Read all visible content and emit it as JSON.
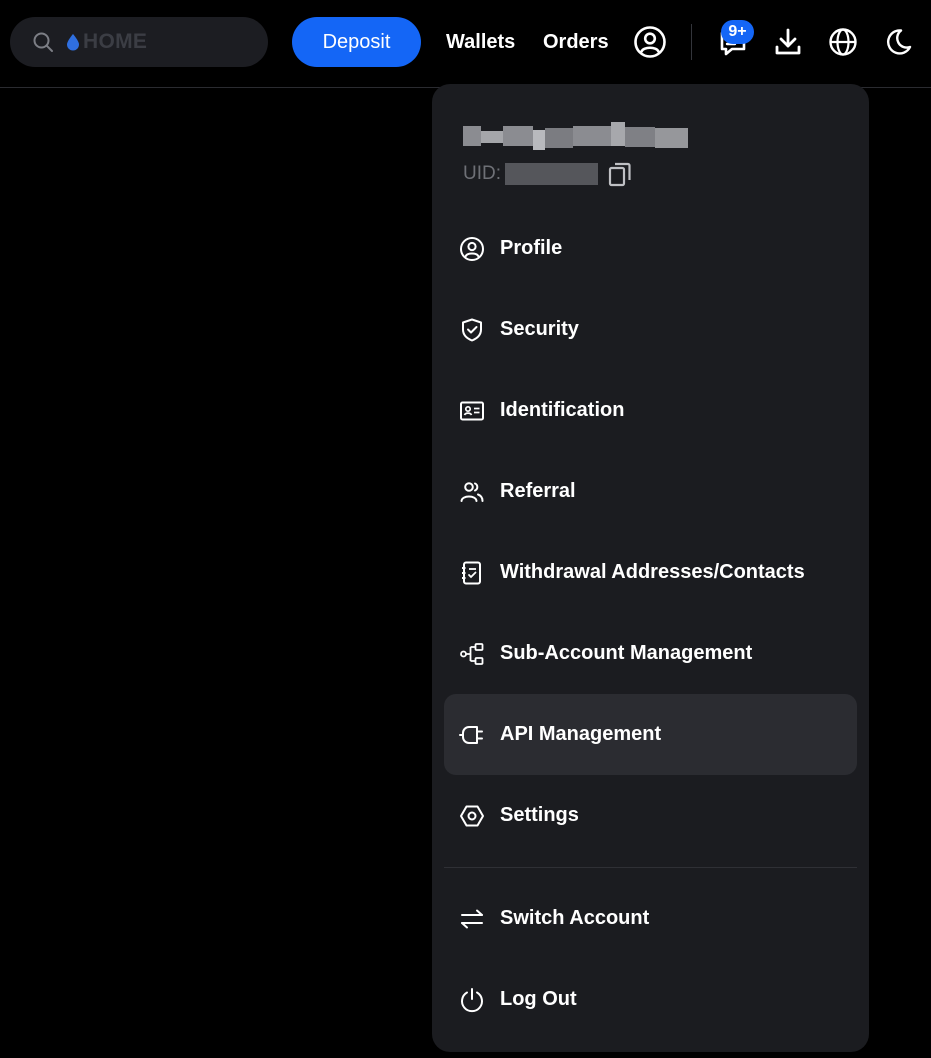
{
  "header": {
    "search": {
      "placeholder": "HOME"
    },
    "deposit_label": "Deposit",
    "nav": {
      "wallets": "Wallets",
      "orders": "Orders"
    },
    "notifications_badge": "9+",
    "icons": [
      "search-icon",
      "droplet-icon",
      "user-circle-icon",
      "message-icon",
      "download-icon",
      "globe-icon",
      "moon-icon"
    ],
    "accent_color": "#1466f6"
  },
  "account_menu": {
    "uid_label": "UID:",
    "items": [
      {
        "label": "Profile",
        "icon": "user-circle-icon"
      },
      {
        "label": "Security",
        "icon": "shield-check-icon"
      },
      {
        "label": "Identification",
        "icon": "id-card-icon"
      },
      {
        "label": "Referral",
        "icon": "users-icon"
      },
      {
        "label": "Withdrawal Addresses/Contacts",
        "icon": "address-book-icon"
      },
      {
        "label": "Sub-Account Management",
        "icon": "branch-icon"
      },
      {
        "label": "API Management",
        "icon": "plug-icon",
        "highlighted": true
      },
      {
        "label": "Settings",
        "icon": "settings-icon"
      }
    ],
    "footer_items": [
      {
        "label": "Switch Account",
        "icon": "swap-icon"
      },
      {
        "label": "Log Out",
        "icon": "power-icon"
      }
    ]
  }
}
